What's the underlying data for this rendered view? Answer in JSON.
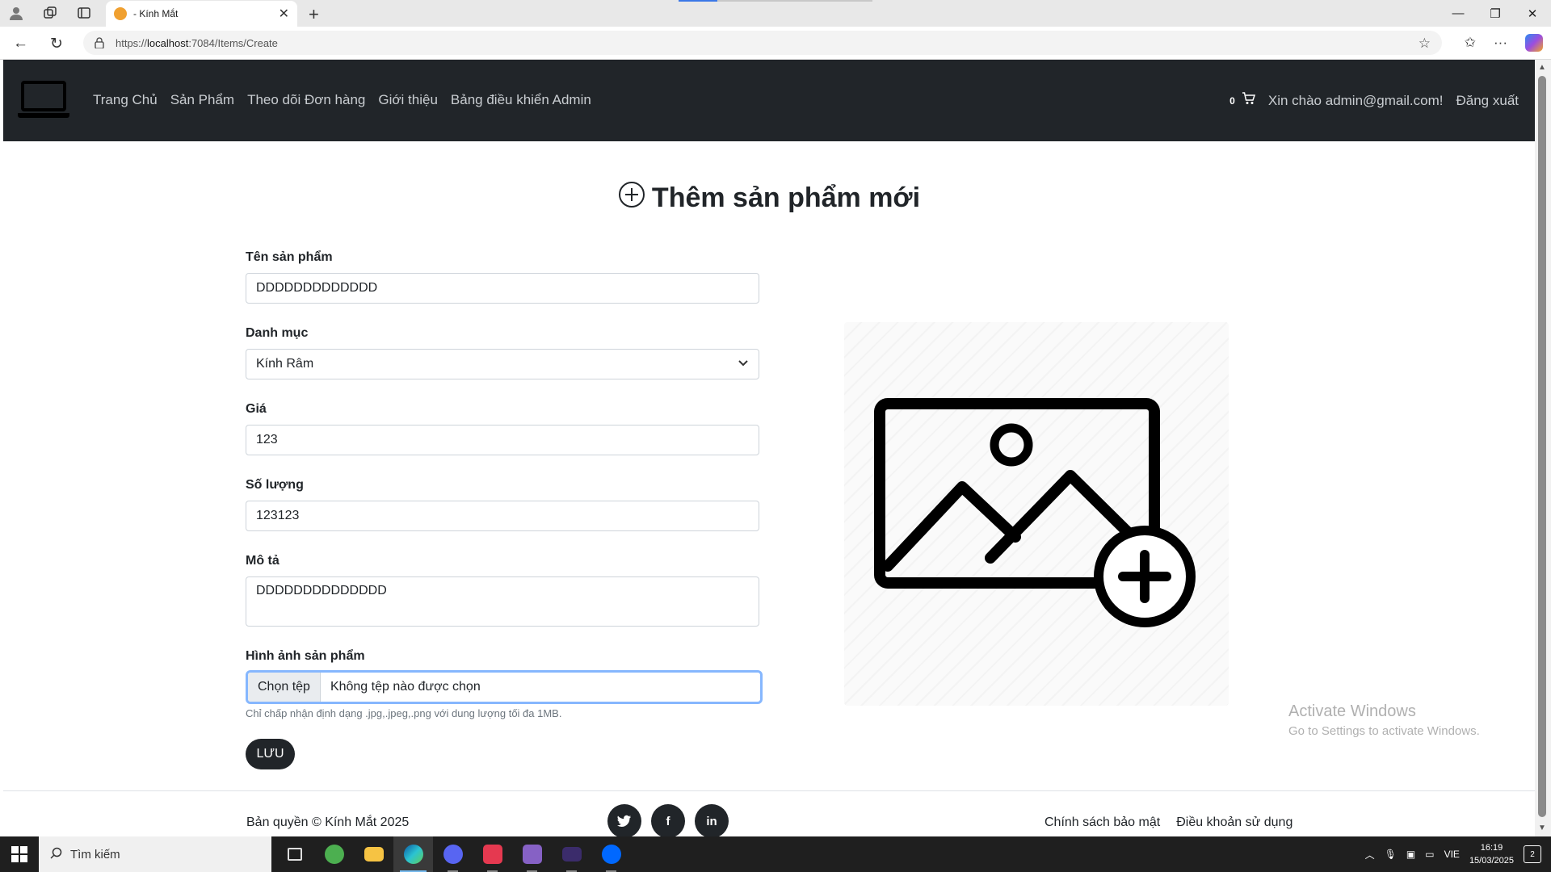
{
  "browser": {
    "tab_title": "- Kính Mắt",
    "url_prefix": "https://",
    "url_host": "localhost",
    "url_rest": ":7084/Items/Create"
  },
  "navbar": {
    "links": [
      "Trang Chủ",
      "Sản Phẩm",
      "Theo dõi Đơn hàng",
      "Giới thiệu",
      "Bảng điều khiển Admin"
    ],
    "cart_count": "0",
    "greeting": "Xin chào admin@gmail.com!",
    "logout": "Đăng xuất"
  },
  "page": {
    "title": "Thêm sản phẩm mới"
  },
  "form": {
    "name_label": "Tên sản phẩm",
    "name_value": "DDDDDDDDDDDDD",
    "category_label": "Danh mục",
    "category_value": "Kính Râm",
    "price_label": "Giá",
    "price_value": "123",
    "qty_label": "Số lượng",
    "qty_value": "123123",
    "desc_label": "Mô tả",
    "desc_value": "DDDDDDDDDDDDDD",
    "image_label": "Hình ảnh sản phẩm",
    "file_button": "Chọn tệp",
    "file_status": "Không tệp nào được chọn",
    "help_text": "Chỉ chấp nhận định dạng .jpg,.jpeg,.png với dung lượng tối đa 1MB.",
    "save_label": "LƯU"
  },
  "footer": {
    "copyright": "Bản quyền © Kính Mắt 2025",
    "socials": [
      "twitter-icon",
      "facebook-icon",
      "linkedin-icon"
    ],
    "links": [
      "Chính sách bảo mật",
      "Điều khoản sử dụng"
    ]
  },
  "watermark": {
    "line1": "Activate Windows",
    "line2": "Go to Settings to activate Windows."
  },
  "taskbar": {
    "search_placeholder": "Tìm kiếm",
    "lang": "VIE",
    "time": "16:19",
    "date": "15/03/2025",
    "notifications": "2"
  },
  "colors": {
    "navbar_bg": "#212529",
    "focus_ring": "#86b7fe"
  }
}
